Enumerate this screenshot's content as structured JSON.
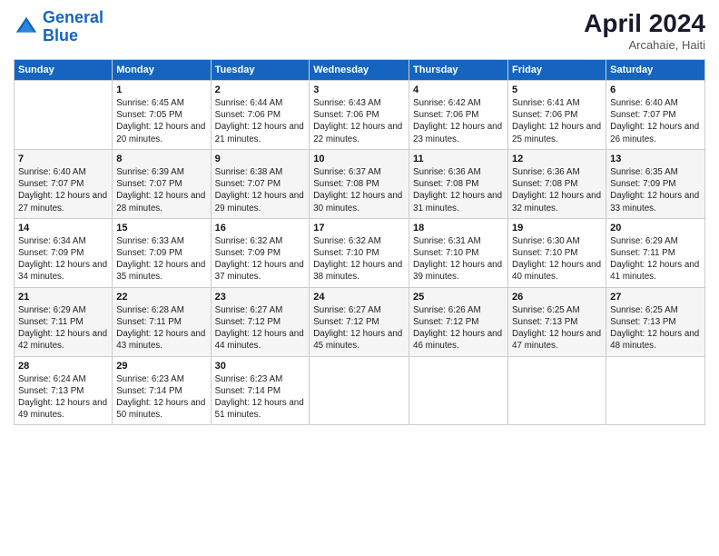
{
  "header": {
    "logo_line1": "General",
    "logo_line2": "Blue",
    "month": "April 2024",
    "location": "Arcahaie, Haiti"
  },
  "days": [
    "Sunday",
    "Monday",
    "Tuesday",
    "Wednesday",
    "Thursday",
    "Friday",
    "Saturday"
  ],
  "weeks": [
    [
      {
        "date": "",
        "info": ""
      },
      {
        "date": "1",
        "info": "Sunrise: 6:45 AM\nSunset: 7:05 PM\nDaylight: 12 hours\nand 20 minutes."
      },
      {
        "date": "2",
        "info": "Sunrise: 6:44 AM\nSunset: 7:06 PM\nDaylight: 12 hours\nand 21 minutes."
      },
      {
        "date": "3",
        "info": "Sunrise: 6:43 AM\nSunset: 7:06 PM\nDaylight: 12 hours\nand 22 minutes."
      },
      {
        "date": "4",
        "info": "Sunrise: 6:42 AM\nSunset: 7:06 PM\nDaylight: 12 hours\nand 23 minutes."
      },
      {
        "date": "5",
        "info": "Sunrise: 6:41 AM\nSunset: 7:06 PM\nDaylight: 12 hours\nand 25 minutes."
      },
      {
        "date": "6",
        "info": "Sunrise: 6:40 AM\nSunset: 7:07 PM\nDaylight: 12 hours\nand 26 minutes."
      }
    ],
    [
      {
        "date": "7",
        "info": "Sunrise: 6:40 AM\nSunset: 7:07 PM\nDaylight: 12 hours\nand 27 minutes."
      },
      {
        "date": "8",
        "info": "Sunrise: 6:39 AM\nSunset: 7:07 PM\nDaylight: 12 hours\nand 28 minutes."
      },
      {
        "date": "9",
        "info": "Sunrise: 6:38 AM\nSunset: 7:07 PM\nDaylight: 12 hours\nand 29 minutes."
      },
      {
        "date": "10",
        "info": "Sunrise: 6:37 AM\nSunset: 7:08 PM\nDaylight: 12 hours\nand 30 minutes."
      },
      {
        "date": "11",
        "info": "Sunrise: 6:36 AM\nSunset: 7:08 PM\nDaylight: 12 hours\nand 31 minutes."
      },
      {
        "date": "12",
        "info": "Sunrise: 6:36 AM\nSunset: 7:08 PM\nDaylight: 12 hours\nand 32 minutes."
      },
      {
        "date": "13",
        "info": "Sunrise: 6:35 AM\nSunset: 7:09 PM\nDaylight: 12 hours\nand 33 minutes."
      }
    ],
    [
      {
        "date": "14",
        "info": "Sunrise: 6:34 AM\nSunset: 7:09 PM\nDaylight: 12 hours\nand 34 minutes."
      },
      {
        "date": "15",
        "info": "Sunrise: 6:33 AM\nSunset: 7:09 PM\nDaylight: 12 hours\nand 35 minutes."
      },
      {
        "date": "16",
        "info": "Sunrise: 6:32 AM\nSunset: 7:09 PM\nDaylight: 12 hours\nand 37 minutes."
      },
      {
        "date": "17",
        "info": "Sunrise: 6:32 AM\nSunset: 7:10 PM\nDaylight: 12 hours\nand 38 minutes."
      },
      {
        "date": "18",
        "info": "Sunrise: 6:31 AM\nSunset: 7:10 PM\nDaylight: 12 hours\nand 39 minutes."
      },
      {
        "date": "19",
        "info": "Sunrise: 6:30 AM\nSunset: 7:10 PM\nDaylight: 12 hours\nand 40 minutes."
      },
      {
        "date": "20",
        "info": "Sunrise: 6:29 AM\nSunset: 7:11 PM\nDaylight: 12 hours\nand 41 minutes."
      }
    ],
    [
      {
        "date": "21",
        "info": "Sunrise: 6:29 AM\nSunset: 7:11 PM\nDaylight: 12 hours\nand 42 minutes."
      },
      {
        "date": "22",
        "info": "Sunrise: 6:28 AM\nSunset: 7:11 PM\nDaylight: 12 hours\nand 43 minutes."
      },
      {
        "date": "23",
        "info": "Sunrise: 6:27 AM\nSunset: 7:12 PM\nDaylight: 12 hours\nand 44 minutes."
      },
      {
        "date": "24",
        "info": "Sunrise: 6:27 AM\nSunset: 7:12 PM\nDaylight: 12 hours\nand 45 minutes."
      },
      {
        "date": "25",
        "info": "Sunrise: 6:26 AM\nSunset: 7:12 PM\nDaylight: 12 hours\nand 46 minutes."
      },
      {
        "date": "26",
        "info": "Sunrise: 6:25 AM\nSunset: 7:13 PM\nDaylight: 12 hours\nand 47 minutes."
      },
      {
        "date": "27",
        "info": "Sunrise: 6:25 AM\nSunset: 7:13 PM\nDaylight: 12 hours\nand 48 minutes."
      }
    ],
    [
      {
        "date": "28",
        "info": "Sunrise: 6:24 AM\nSunset: 7:13 PM\nDaylight: 12 hours\nand 49 minutes."
      },
      {
        "date": "29",
        "info": "Sunrise: 6:23 AM\nSunset: 7:14 PM\nDaylight: 12 hours\nand 50 minutes."
      },
      {
        "date": "30",
        "info": "Sunrise: 6:23 AM\nSunset: 7:14 PM\nDaylight: 12 hours\nand 51 minutes."
      },
      {
        "date": "",
        "info": ""
      },
      {
        "date": "",
        "info": ""
      },
      {
        "date": "",
        "info": ""
      },
      {
        "date": "",
        "info": ""
      }
    ]
  ]
}
